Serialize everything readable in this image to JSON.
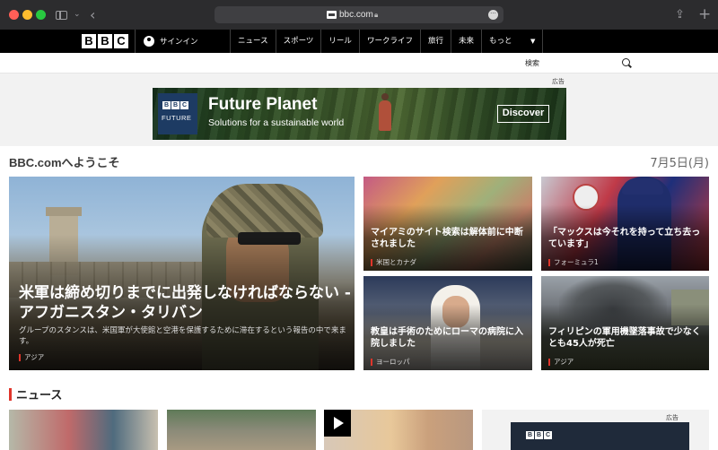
{
  "browser": {
    "url": "bbc.com",
    "icons": [
      "sidebar-icon",
      "chevron-down-icon",
      "back-icon",
      "lock-icon",
      "more-icon",
      "share-icon",
      "new-tab-icon"
    ]
  },
  "nav": {
    "logo_letters": [
      "B",
      "B",
      "C"
    ],
    "signin": "サインイン",
    "items": [
      "ニュース",
      "スポーツ",
      "リール",
      "ワークライフ",
      "旅行",
      "未来",
      "もっと"
    ]
  },
  "search": {
    "label": "検索"
  },
  "ad_top": {
    "label": "広告",
    "logo_bbc": [
      "B",
      "B",
      "C"
    ],
    "logo_sub": "FUTURE",
    "title": "Future Planet",
    "subtitle": "Solutions for a sustainable world",
    "cta": "Discover"
  },
  "welcome": {
    "title": "BBC.comへようこそ",
    "date": "7月5日(月)"
  },
  "hero": {
    "headline": "米軍は締め切りまでに出発しなければならない - アフガニスタン・タリバン",
    "snippet": "グループのスタンスは、米国軍が大使館と空港を保護するために滞在するという報告の中で来ます。",
    "tag": "アジア"
  },
  "cards": [
    {
      "headline": "マイアミのサイト検索は解体前に中断されました",
      "tag": "米国とカナダ"
    },
    {
      "headline": "「マックスは今それを持って立ち去っています」",
      "tag": "フォーミュラ1"
    },
    {
      "headline": "教皇は手術のためにローマの病院に入院しました",
      "tag": "ヨーロッパ"
    },
    {
      "headline": "フィリピンの軍用機墜落事故で少なくとも45人が死亡",
      "tag": "アジア"
    }
  ],
  "news": {
    "heading": "ニュース"
  },
  "ad_bottom": {
    "label": "広告",
    "logo_bbc": [
      "B",
      "B",
      "C"
    ]
  },
  "colors": {
    "accent": "#e0352b",
    "nav_bg": "#000000",
    "ad_logo": "#1d3b63"
  }
}
